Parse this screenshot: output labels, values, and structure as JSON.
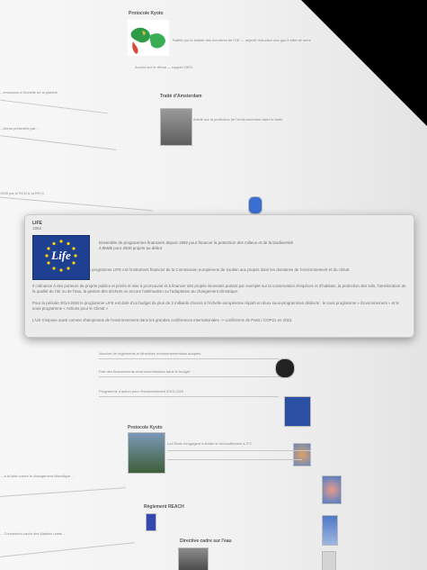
{
  "life_card": {
    "title": "LIFE",
    "year": "1992",
    "summary_line1": "Ensemble de programmes financiers depuis 1992 pour financer la protection des milieux et de la biodiversité",
    "summary_line2": "3,9Md€ pour 2500 projets au début",
    "para1": "Le programme LIFE est l'instrument financier de la Commission européenne de soutien aux projets dans les domaines de l'environnement et du climat.",
    "para2": "Il cofinance à des porteurs de projets publics et privés et vise à promouvoir et à financer des projets innovants portant par exemple sur la conservation d'espèces et d'habitats, la protection des sols, l'amélioration de la qualité de l'air ou de l'eau, la gestion des déchets ou encore l'atténuation ou l'adaptation au changement climatique.",
    "para3": "Pour la période 2014-2020 le programme LIFE est doté d'un budget de plus de 3 milliards d'euros à l'échelle européenne réparti en deux sous-programmes distincts : le sous programme « Environnement » et le sous-programme « Actions pour le Climat »",
    "para4": "L'UE s'impose aussi comme championne de l'environnement dans les grandes conférences internationales -> conférence de Paris / COP21 en 2015.",
    "logo_text": "Life"
  },
  "background": {
    "top_title": "Protocole Kyoto",
    "left_snippet1": "...emissions à l'échelle de la planète",
    "left_snippet2": "...climat présentés par...",
    "mid_label1": "1999 par le RCN & la RFLC",
    "mid_label2": "Traité d'Amsterdam",
    "mid_label3": "...",
    "lower_label1": "Protocole Kyoto",
    "lower_label2": "Règlement REACH",
    "lower_label3": "Directive cadre sur l'eau",
    "lower_label4": "Conférence de Paris"
  },
  "colors": {
    "card_bg": "#ececec",
    "eu_blue": "#1f3f93",
    "eu_star": "#f6d300"
  }
}
